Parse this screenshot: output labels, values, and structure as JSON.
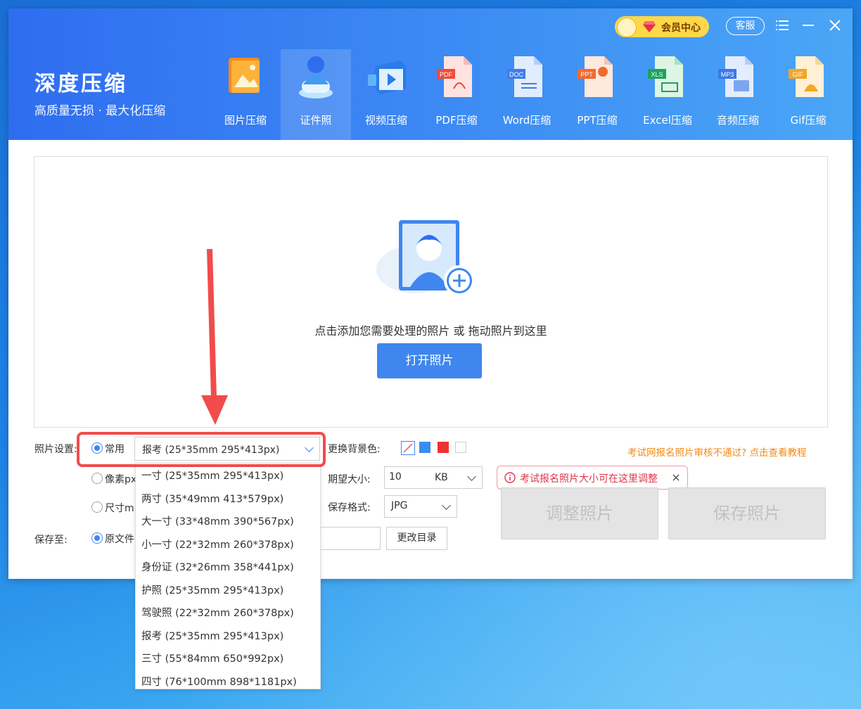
{
  "app": {
    "title": "深度压缩",
    "subtitle": "高质量无损 · 最大化压缩",
    "vip_label": "会员中心",
    "service_label": "客服"
  },
  "tabs": [
    {
      "label": "图片压缩",
      "icon": "image-icon"
    },
    {
      "label": "证件照",
      "icon": "id-photo-icon",
      "active": true
    },
    {
      "label": "视频压缩",
      "icon": "video-icon"
    },
    {
      "label": "PDF压缩",
      "icon": "pdf-icon",
      "badge": "PDF"
    },
    {
      "label": "Word压缩",
      "icon": "word-icon",
      "badge": "DOC"
    },
    {
      "label": "PPT压缩",
      "icon": "ppt-icon",
      "badge": "PPT"
    },
    {
      "label": "Excel压缩",
      "icon": "excel-icon",
      "badge": "XLS"
    },
    {
      "label": "音频压缩",
      "icon": "audio-icon",
      "badge": "MP3"
    },
    {
      "label": "Gif压缩",
      "icon": "gif-icon",
      "badge": "GIF"
    }
  ],
  "drop": {
    "hint": "点击添加您需要处理的照片 或 拖动照片到这里",
    "open_button": "打开照片"
  },
  "settings": {
    "photo_label": "照片设置:",
    "mode_common": "常用",
    "mode_pixel": "像素px",
    "mode_size": "尺寸mm",
    "selected_size": "报考 (25*35mm 295*413px)",
    "bg_label": "更换背景色:",
    "bg_colors": [
      "#3a8df0",
      "#f03232",
      "#ffffff"
    ],
    "tutorial_link": "考试网报名照片审核不通过? 点击查看教程",
    "size_label": "期望大小:",
    "size_value": "10",
    "size_unit": "KB",
    "format_label": "保存格式:",
    "format_value": "JPG",
    "save_label": "保存至:",
    "save_option": "原文件",
    "change_dir": "更改目录",
    "tip": "考试报名照片大小可在这里调整"
  },
  "actions": {
    "adjust": "调整照片",
    "save": "保存照片"
  },
  "size_options": [
    "一寸 (25*35mm 295*413px)",
    "两寸 (35*49mm 413*579px)",
    "大一寸 (33*48mm 390*567px)",
    "小一寸 (22*32mm 260*378px)",
    "身份证 (32*26mm 358*441px)",
    "护照 (25*35mm 295*413px)",
    "驾驶照 (22*32mm 260*378px)",
    "报考 (25*35mm 295*413px)",
    "三寸 (55*84mm 650*992px)",
    "四寸 (76*100mm 898*1181px)"
  ],
  "colors": {
    "accent": "#3f86ef",
    "annotation": "#f24b4b",
    "header_start": "#2f6df0",
    "header_end": "#4aa6f6"
  }
}
